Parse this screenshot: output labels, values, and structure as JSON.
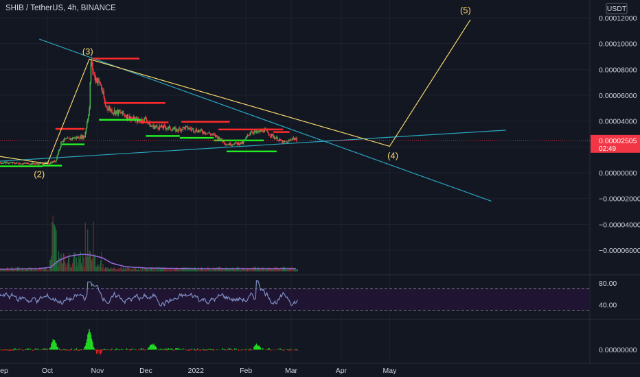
{
  "header": {
    "symbol_title": "SHIB / TetherUS, 4h, BINANCE",
    "currency_button": "USDT"
  },
  "price_badge": {
    "price": "0.00002505",
    "countdown": "02:49",
    "color": "#f23645"
  },
  "colors": {
    "background": "#131722",
    "bull": "#4caf50",
    "bear": "#f23645",
    "trendline": "#2aa6c0",
    "wave_line": "#f5d76e",
    "resistance": "#ff2a2a",
    "support": "#22ee22",
    "rsi_line": "#7e8ec4",
    "rsi_band": "#26143a",
    "volume_ma": "#9c6ade",
    "macd_pos": "#22dd22",
    "macd_neg": "#ee2222"
  },
  "chart_data": [
    {
      "type": "line",
      "panel": "price",
      "title": "SHIB / TetherUS, 4h, BINANCE",
      "y_tick_labels": [
        "0.00012000",
        "0.00010000",
        "0.00008000",
        "0.00006000",
        "0.00004000",
        "0.00002000",
        "0.00000000",
        "−0.00002000",
        "−0.00004000",
        "−0.00006000"
      ],
      "ylim": [
        -6.8e-05,
        0.000125
      ],
      "x_tick_labels": [
        "ep",
        "Oct",
        "Nov",
        "Dec",
        "2022",
        "Feb",
        "Mar",
        "Apr",
        "May"
      ],
      "x_tick_dates": [
        "2021-09-01",
        "2021-10-01",
        "2021-11-01",
        "2021-12-01",
        "2022-01-01",
        "2022-02-01",
        "2022-03-01",
        "2022-04-01",
        "2022-05-01"
      ],
      "series": [
        {
          "x": [
            "2021-08-25",
            "2021-09-05",
            "2021-09-15",
            "2021-09-25",
            "2021-10-02",
            "2021-10-06",
            "2021-10-10",
            "2021-10-18",
            "2021-10-24",
            "2021-10-27",
            "2021-10-28",
            "2021-10-30",
            "2021-11-03",
            "2021-11-06",
            "2021-11-10",
            "2021-11-16",
            "2021-11-22",
            "2021-11-27",
            "2021-12-01",
            "2021-12-04",
            "2021-12-08",
            "2021-12-14",
            "2021-12-20",
            "2021-12-25",
            "2022-01-01",
            "2022-01-08",
            "2022-01-14",
            "2022-01-20",
            "2022-01-24",
            "2022-01-30",
            "2022-02-04",
            "2022-02-08",
            "2022-02-12",
            "2022-02-18",
            "2022-02-24",
            "2022-02-27",
            "2022-03-02",
            "2022-03-05"
          ],
          "values": [
            7.7e-06,
            7.8e-06,
            7.2e-06,
            7e-06,
            7.5e-06,
            9e-06,
            2.5e-05,
            2.7e-05,
            2.8e-05,
            5e-05,
            8.6e-05,
            7.5e-05,
            6.8e-05,
            5.2e-05,
            4.8e-05,
            4.6e-05,
            4.2e-05,
            4e-05,
            4.2e-05,
            3.6e-05,
            3.55e-05,
            3.5e-05,
            3.3e-05,
            3.5e-05,
            3.3e-05,
            3.1e-05,
            2.8e-05,
            2.2e-05,
            2.25e-05,
            2.3e-05,
            3.2e-05,
            3.1e-05,
            3.3e-05,
            2.8e-05,
            2.35e-05,
            2.4e-05,
            2.7e-05,
            2.5e-05
          ]
        }
      ],
      "resistance_levels": [
        {
          "from": "2021-10-06",
          "to": "2021-10-24",
          "value": 3.4e-05
        },
        {
          "from": "2021-10-29",
          "to": "2021-11-27",
          "value": 8.85e-05
        },
        {
          "from": "2021-11-05",
          "to": "2021-12-13",
          "value": 5.4e-05
        },
        {
          "from": "2021-11-27",
          "to": "2021-12-15",
          "value": 3.9e-05
        },
        {
          "from": "2021-12-23",
          "to": "2022-01-22",
          "value": 3.95e-05
        },
        {
          "from": "2022-01-15",
          "to": "2022-02-18",
          "value": 3.35e-05
        },
        {
          "from": "2022-02-10",
          "to": "2022-02-24",
          "value": 3.35e-05
        },
        {
          "from": "2022-02-18",
          "to": "2022-02-28",
          "value": 3.15e-05
        }
      ],
      "support_levels": [
        {
          "from": "2021-08-25",
          "to": "2021-09-28",
          "value": 5e-06
        },
        {
          "from": "2021-09-28",
          "to": "2021-10-10",
          "value": 5.5e-06
        },
        {
          "from": "2021-10-10",
          "to": "2021-10-24",
          "value": 2.2e-05
        },
        {
          "from": "2021-11-02",
          "to": "2021-11-28",
          "value": 4.1e-05
        },
        {
          "from": "2021-12-01",
          "to": "2021-12-22",
          "value": 2.85e-05
        },
        {
          "from": "2021-12-22",
          "to": "2022-01-12",
          "value": 2.7e-05
        },
        {
          "from": "2022-01-12",
          "to": "2022-02-12",
          "value": 2.5e-05
        },
        {
          "from": "2022-01-20",
          "to": "2022-02-20",
          "value": 1.65e-05
        }
      ],
      "trendlines": [
        {
          "from": {
            "x": "2021-09-26",
            "y": 0.0001035
          },
          "to": {
            "x": "2022-07-03",
            "y": -2.2e-05
          }
        },
        {
          "from": {
            "x": "2021-08-20",
            "y": 8e-06
          },
          "to": {
            "x": "2022-07-12",
            "y": 3.3e-05
          }
        }
      ],
      "wave_path": [
        {
          "x": "2021-08-20",
          "y": 1.5e-05
        },
        {
          "x": "2021-10-01",
          "y": 7e-06
        },
        {
          "x": "2021-10-27",
          "y": 8.8e-05
        },
        {
          "x": "2022-05-01",
          "y": 2.05e-05
        },
        {
          "x": "2022-06-20",
          "y": 0.0001185
        }
      ],
      "wave_labels": [
        {
          "text": "(2)",
          "x": "2021-09-26",
          "y": -3.5e-06
        },
        {
          "text": "(3)",
          "x": "2021-10-26",
          "y": 9.15e-05
        },
        {
          "text": "(4)",
          "x": "2022-05-03",
          "y": 1.1e-05
        },
        {
          "text": "(5)",
          "x": "2022-06-17",
          "y": 0.0001235
        }
      ],
      "last_price": 2.505e-05
    },
    {
      "type": "bar",
      "panel": "volume",
      "note_ma": true
    },
    {
      "type": "line",
      "panel": "rsi",
      "y_tick_labels": [
        "80.00",
        "40.00"
      ],
      "band": [
        30,
        70
      ],
      "ylim": [
        18,
        90
      ]
    },
    {
      "type": "bar",
      "panel": "macd",
      "y_tick_labels": [
        "0.00000000"
      ]
    }
  ]
}
